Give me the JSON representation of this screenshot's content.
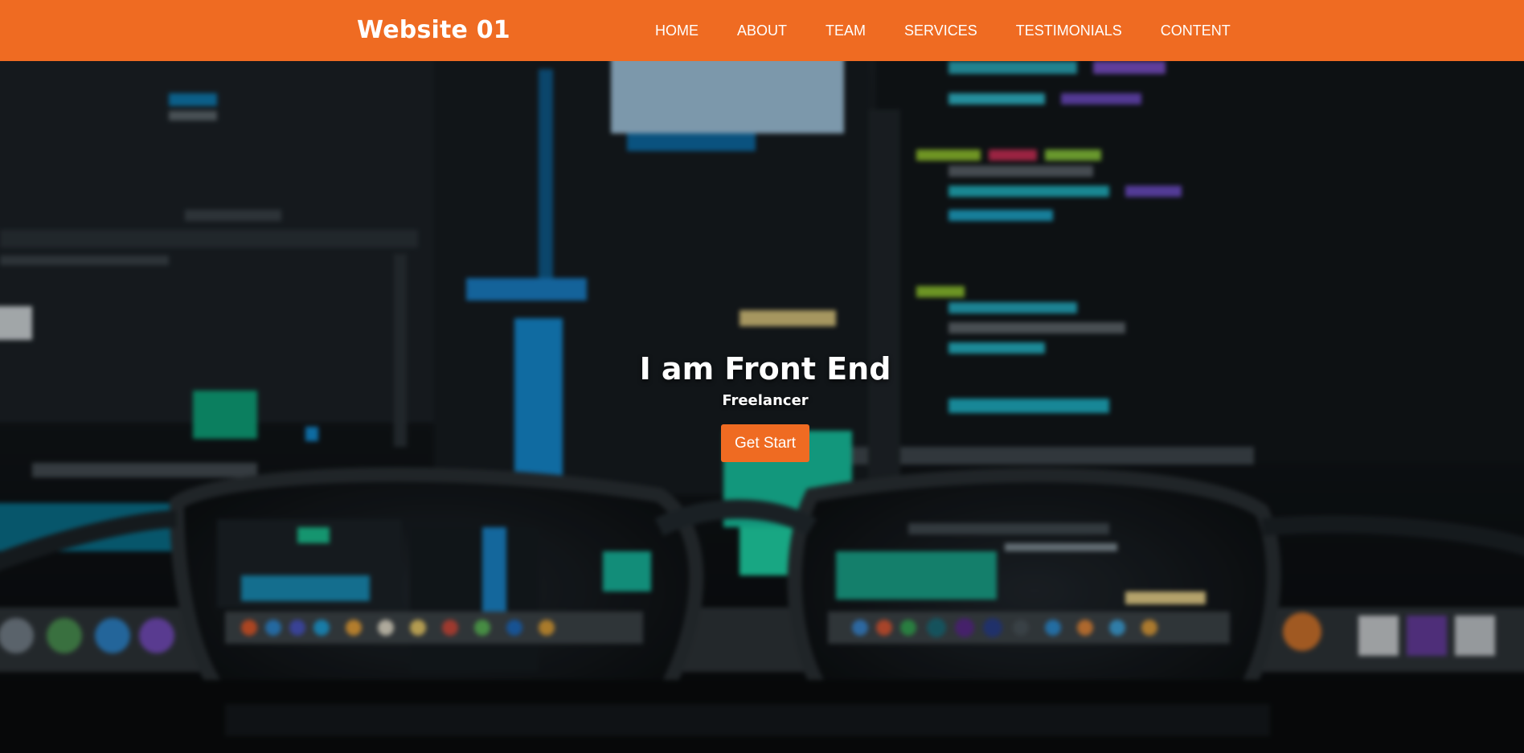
{
  "header": {
    "brand": "Website 01",
    "nav": [
      {
        "label": "HOME"
      },
      {
        "label": "ABOUT"
      },
      {
        "label": "TEAM"
      },
      {
        "label": "SERVICES"
      },
      {
        "label": "TESTIMONIALS"
      },
      {
        "label": "CONTENT"
      }
    ]
  },
  "hero": {
    "title": "I am Front End",
    "subtitle": "Freelancer",
    "cta_label": "Get Start"
  },
  "colors": {
    "accent": "#ef6b22",
    "text_light": "#ffffff",
    "hero_dark": "#0d1114"
  },
  "icons": [
    "background-photo-code-monitor-glasses"
  ]
}
